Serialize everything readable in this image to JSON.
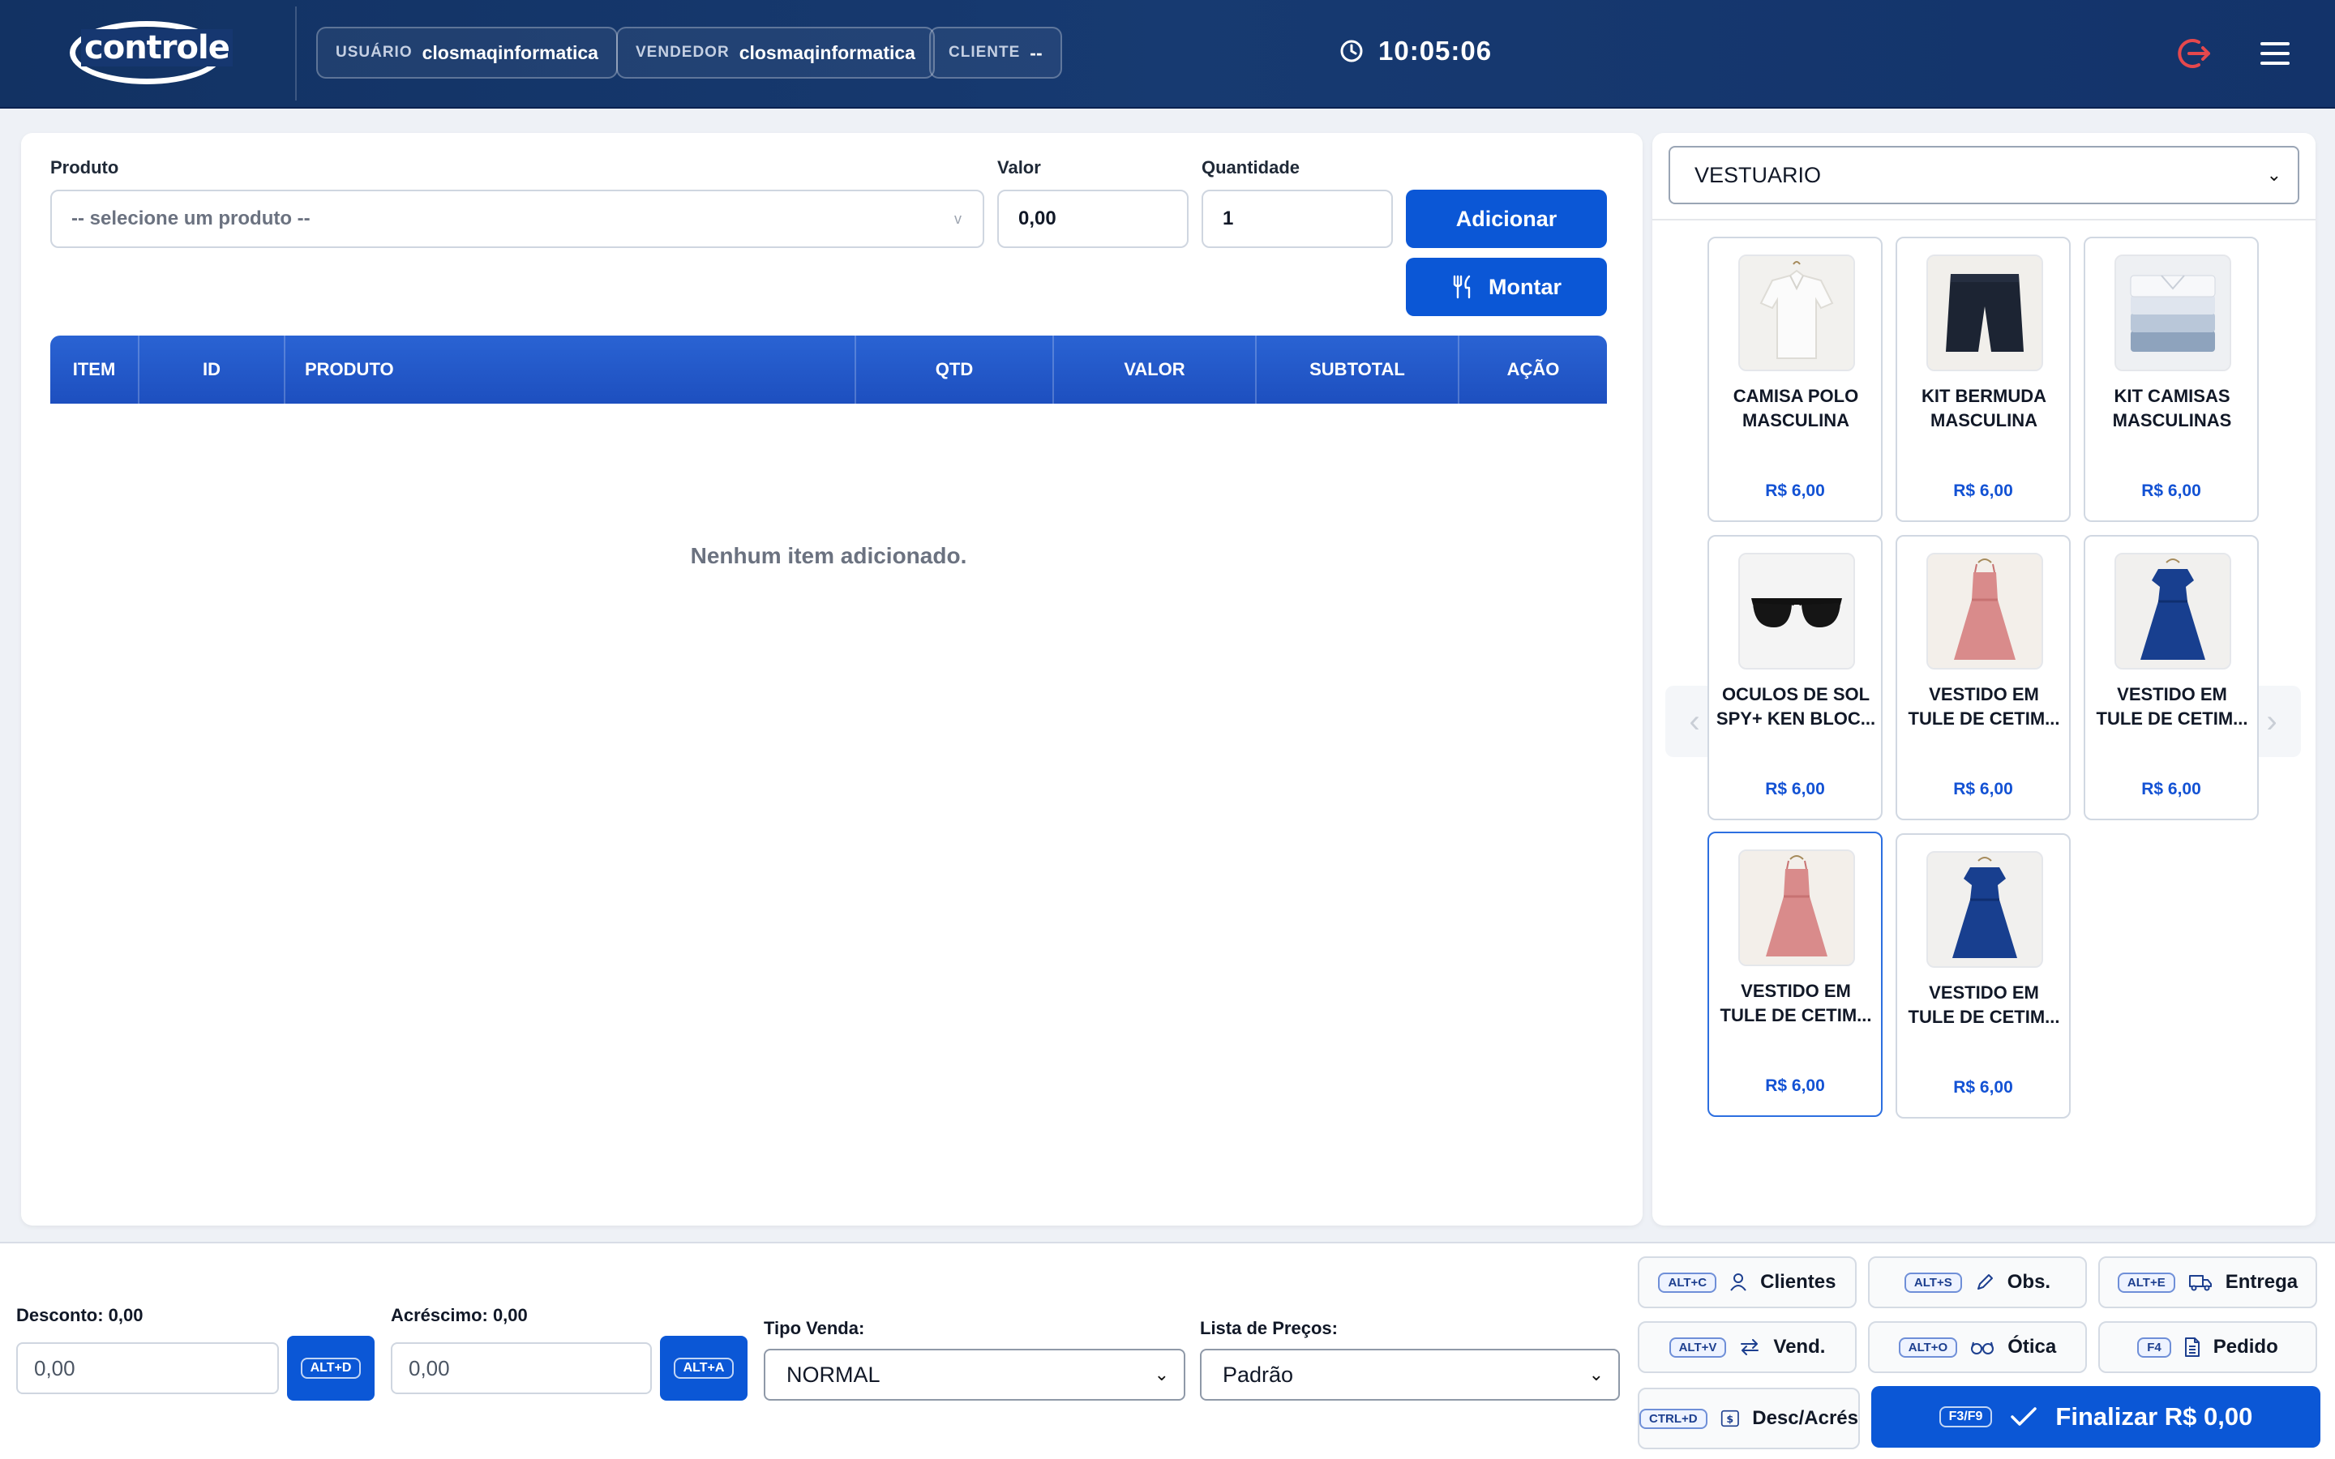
{
  "app": {
    "logo_text": "controle"
  },
  "header": {
    "usuario": {
      "key": "USUÁRIO",
      "value": "closmaqinformatica"
    },
    "vendedor": {
      "key": "VENDEDOR",
      "value": "closmaqinformatica"
    },
    "cliente": {
      "key": "CLIENTE",
      "value": "--"
    },
    "clock": "10:05:06"
  },
  "form": {
    "produto_label": "Produto",
    "produto_placeholder": "-- selecione um produto --",
    "valor_label": "Valor",
    "valor_value": "0,00",
    "quantidade_label": "Quantidade",
    "quantidade_value": "1",
    "adicionar_label": "Adicionar",
    "montar_label": "Montar"
  },
  "table": {
    "columns": [
      "ITEM",
      "ID",
      "PRODUTO",
      "QTD",
      "VALOR",
      "SUBTOTAL",
      "AÇÃO"
    ],
    "empty_message": "Nenhum item adicionado."
  },
  "catalog": {
    "category": "VESTUARIO",
    "products": [
      {
        "line1": "CAMISA POLO",
        "line2": "MASCULINA",
        "price": "R$ 6,00",
        "image": "white-polo-shirt"
      },
      {
        "line1": "KIT BERMUDA",
        "line2": "MASCULINA",
        "price": "R$ 6,00",
        "image": "navy-shorts"
      },
      {
        "line1": "KIT CAMISAS",
        "line2": "MASCULINAS",
        "price": "R$ 6,00",
        "image": "folded-shirts"
      },
      {
        "line1": "OCULOS DE SOL",
        "line2": "SPY+ KEN BLOC...",
        "price": "R$ 6,00",
        "image": "sunglasses"
      },
      {
        "line1": "VESTIDO EM",
        "line2": "TULE DE CETIM...",
        "price": "R$ 6,00",
        "image": "pink-dress"
      },
      {
        "line1": "VESTIDO EM",
        "line2": "TULE DE CETIM...",
        "price": "R$ 6,00",
        "image": "blue-dress"
      },
      {
        "line1": "VESTIDO EM",
        "line2": "TULE DE CETIM...",
        "price": "R$ 6,00",
        "image": "pink-dress",
        "selected": true
      },
      {
        "line1": "VESTIDO EM",
        "line2": "TULE DE CETIM...",
        "price": "R$ 6,00",
        "image": "blue-dress"
      }
    ]
  },
  "footer": {
    "desconto_label": "Desconto: 0,00",
    "desconto_value": "0,00",
    "desconto_shortcut": "ALT+D",
    "acrescimo_label": "Acréscimo: 0,00",
    "acrescimo_value": "0,00",
    "acrescimo_shortcut": "ALT+A",
    "tipo_venda_label": "Tipo Venda:",
    "tipo_venda_value": "NORMAL",
    "lista_precos_label": "Lista de Preços:",
    "lista_precos_value": "Padrão",
    "actions": {
      "clientes": {
        "key": "ALT+C",
        "label": "Clientes"
      },
      "obs": {
        "key": "ALT+S",
        "label": "Obs."
      },
      "entrega": {
        "key": "ALT+E",
        "label": "Entrega"
      },
      "vend": {
        "key": "ALT+V",
        "label": "Vend."
      },
      "otica": {
        "key": "ALT+O",
        "label": "Ótica"
      },
      "pedido": {
        "key": "F4",
        "label": "Pedido"
      },
      "desc_acres": {
        "key": "CTRL+D",
        "label": "Desc/Acrés"
      }
    },
    "finalizar": {
      "key": "F3/F9",
      "label": "Finalizar R$ 0,00"
    }
  },
  "colors": {
    "primary": "#0b57d6",
    "header_bg": "#173a71",
    "price": "#1352d4"
  }
}
